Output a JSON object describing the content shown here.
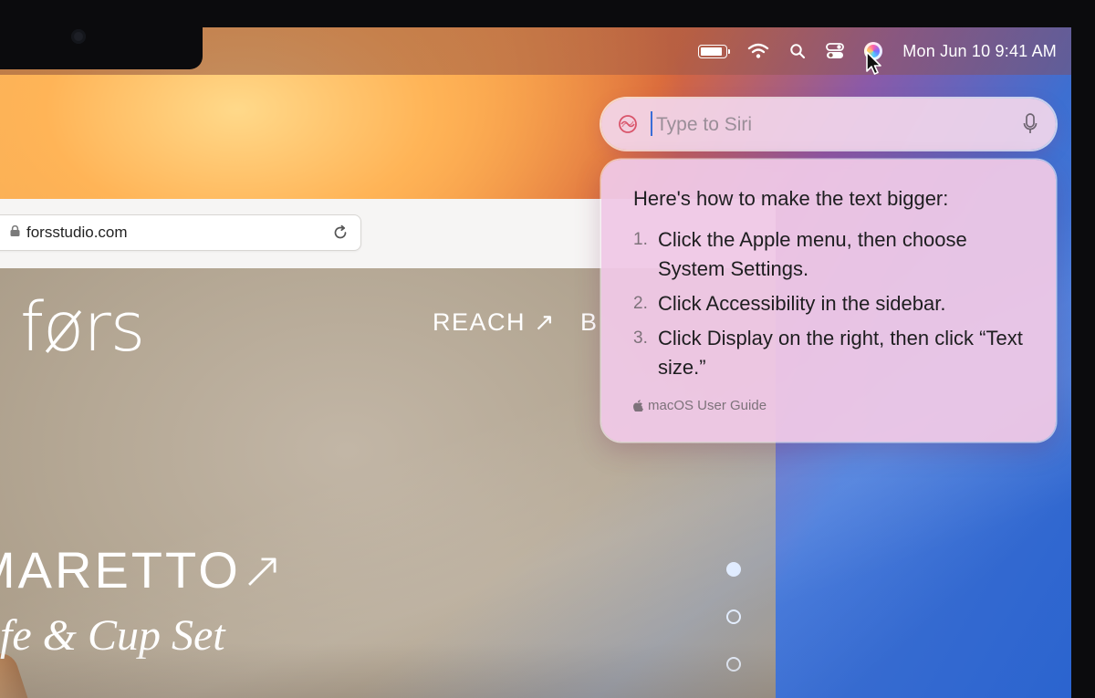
{
  "menubar": {
    "icons": [
      "battery-icon",
      "wifi-icon",
      "search-icon",
      "control-center-icon",
      "siri-icon"
    ],
    "clock": "Mon Jun 10  9:41 AM"
  },
  "browser": {
    "url": "forsstudio.com"
  },
  "website": {
    "logo": "førs",
    "nav": [
      "REACH ↗",
      "B"
    ],
    "product_title": "MARETTO↗",
    "product_subtitle": "afe & Cup Set",
    "slide_indicator": {
      "count": 3,
      "active": 1
    }
  },
  "siri": {
    "input_placeholder": "Type to Siri",
    "response_heading": "Here's how to make the text bigger:",
    "steps": [
      {
        "num": "1.",
        "text": "Click the Apple menu, then choose System Settings."
      },
      {
        "num": "2.",
        "text": "Click Accessibility in the sidebar."
      },
      {
        "num": "3.",
        "text": "Click Display on the right, then click “Text size.”"
      }
    ],
    "source": "macOS User Guide"
  },
  "colors": {
    "caret": "#3a6dd8",
    "siri_card": "#efc8e6"
  }
}
